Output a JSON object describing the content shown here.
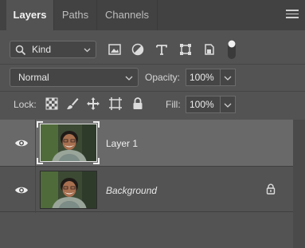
{
  "tabs": [
    {
      "label": "Layers",
      "active": true
    },
    {
      "label": "Paths",
      "active": false
    },
    {
      "label": "Channels",
      "active": false
    }
  ],
  "filter": {
    "kind_label": "Kind",
    "icons": [
      "image-filter-icon",
      "adjustment-filter-icon",
      "type-filter-icon",
      "shape-filter-icon",
      "smart-object-filter-icon",
      "filter-toggle-icon"
    ]
  },
  "blend": {
    "mode": "Normal",
    "opacity_label": "Opacity:",
    "opacity_value": "100%"
  },
  "lock": {
    "label": "Lock:",
    "icons": [
      "lock-transparent-pixels-icon",
      "lock-image-pixels-icon",
      "lock-position-icon",
      "lock-artboard-icon",
      "lock-all-icon"
    ],
    "fill_label": "Fill:",
    "fill_value": "100%"
  },
  "layers": [
    {
      "name": "Layer 1",
      "visible": true,
      "selected": true,
      "locked": false
    },
    {
      "name": "Background",
      "visible": true,
      "selected": false,
      "locked": true
    }
  ],
  "colors": {
    "panel_bg": "#535353",
    "tabbar_bg": "#424242",
    "selected_row": "#696969"
  }
}
